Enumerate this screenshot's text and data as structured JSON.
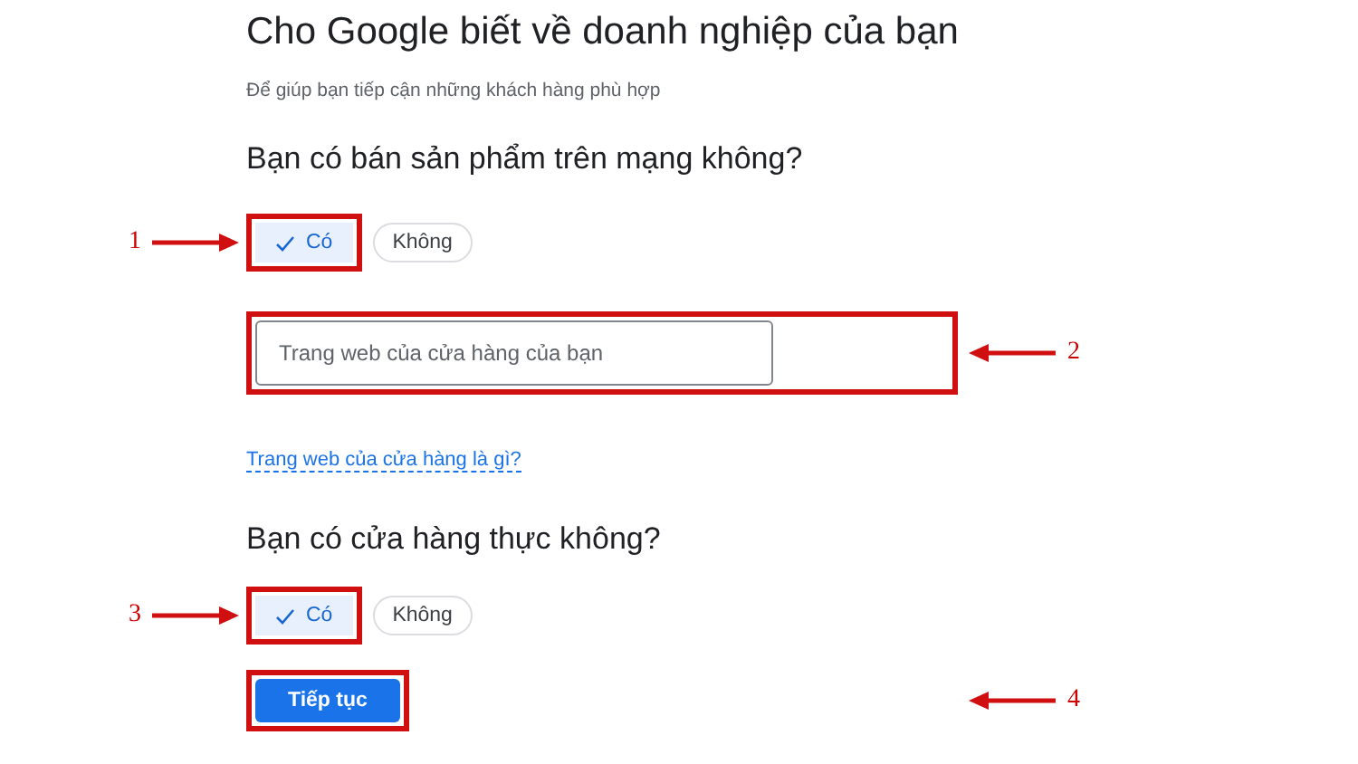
{
  "title": "Cho Google biết về doanh nghiệp của bạn",
  "subtitle": "Để giúp bạn tiếp cận những khách hàng phù hợp",
  "questions": [
    {
      "label": "Bạn có bán sản phẩm trên mạng không?",
      "callout": "1",
      "options": [
        {
          "label": "Có",
          "selected": true
        },
        {
          "label": "Không",
          "selected": false
        }
      ]
    },
    {
      "label": "Bạn có cửa hàng thực không?",
      "callout": "3",
      "options": [
        {
          "label": "Có",
          "selected": true
        },
        {
          "label": "Không",
          "selected": false
        }
      ]
    }
  ],
  "website_field": {
    "placeholder": "Trang web của cửa hàng của bạn",
    "callout": "2"
  },
  "help_link": "Trang web của cửa hàng là gì?",
  "continue_button": {
    "label": "Tiếp tục",
    "callout": "4"
  }
}
